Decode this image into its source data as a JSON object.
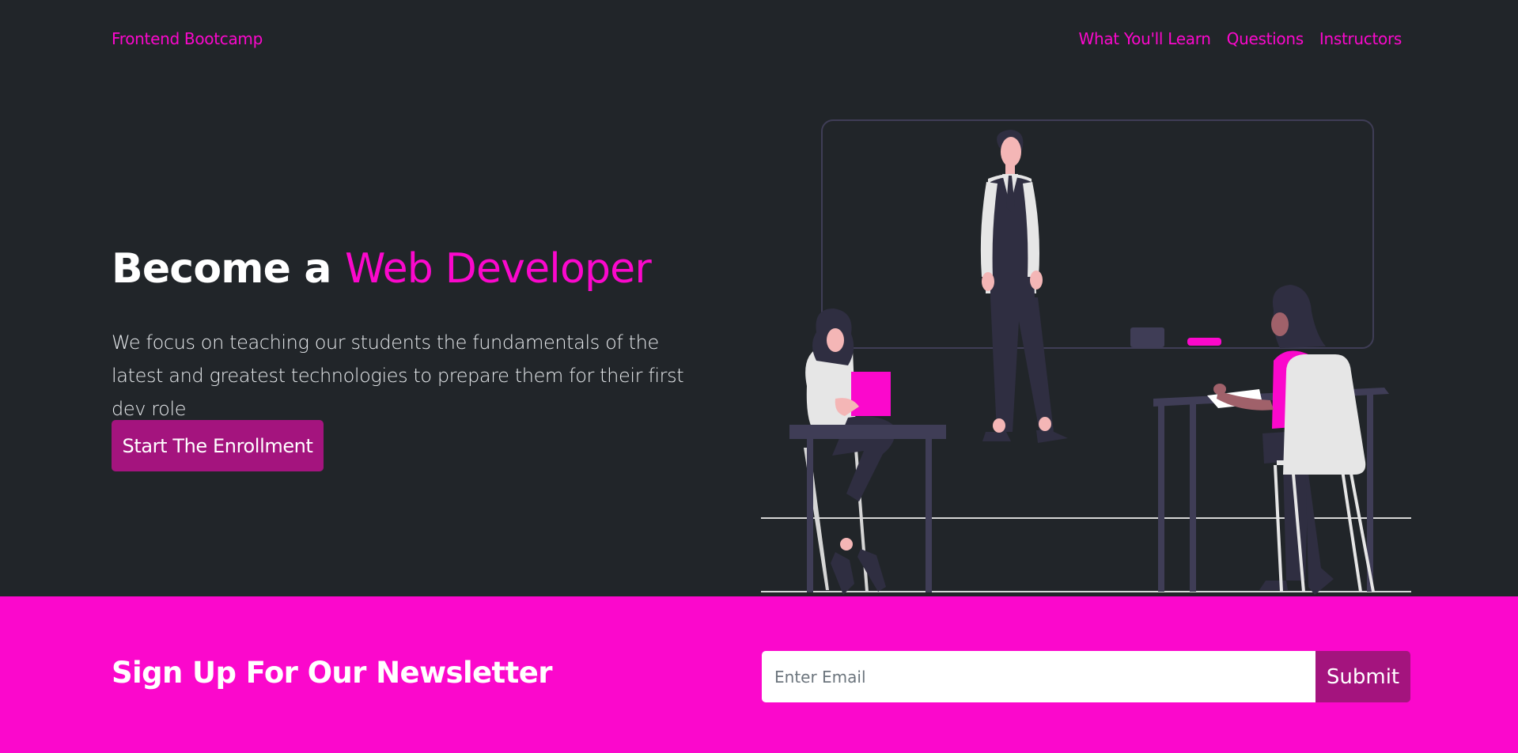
{
  "navbar": {
    "brand": "Frontend Bootcamp",
    "links": [
      "What You'll Learn",
      "Questions",
      "Instructors"
    ]
  },
  "hero": {
    "title_prefix": "Become a ",
    "title_accent": "Web Developer",
    "lead": "We focus on teaching our students the fundamentals of the latest and greatest technologies to prepare them for their first dev role",
    "cta_label": "Start The Enrollment",
    "illustration_icon": "classroom-illustration"
  },
  "newsletter": {
    "title": "Sign Up For Our Newsletter",
    "email_placeholder": "Enter Email",
    "email_value": "",
    "submit_label": "Submit"
  },
  "colors": {
    "background": "#212529",
    "accent": "#fb08cc",
    "button": "#a4147e",
    "text": "#ffffff"
  }
}
